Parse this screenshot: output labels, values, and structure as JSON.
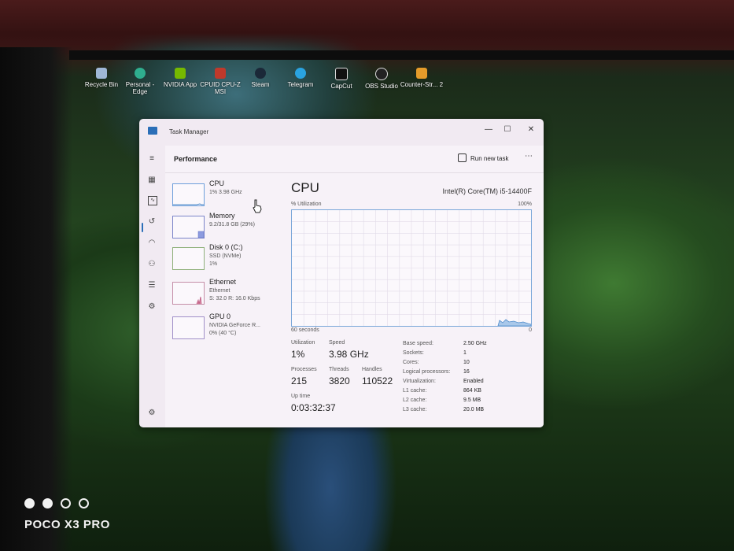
{
  "desktop_icons": [
    {
      "label": "Recycle Bin",
      "icon": "recycle-bin-icon",
      "color": "#9fb7d6"
    },
    {
      "label": "Personal - Edge",
      "icon": "edge-icon",
      "color": "#2fae8f"
    },
    {
      "label": "NVIDIA App",
      "icon": "nvidia-icon",
      "color": "#76b900"
    },
    {
      "label": "CPUID CPU-Z MSI",
      "icon": "cpuz-icon",
      "color": "#c0392b"
    },
    {
      "label": "Steam",
      "icon": "steam-icon",
      "color": "#1b2838"
    },
    {
      "label": "Telegram",
      "icon": "telegram-icon",
      "color": "#2aa3e0"
    },
    {
      "label": "CapCut",
      "icon": "capcut-icon",
      "color": "#111111"
    },
    {
      "label": "OBS Studio",
      "icon": "obs-icon",
      "color": "#222222"
    },
    {
      "label": "Counter-Str... 2",
      "icon": "cs2-icon",
      "color": "#e59b2a"
    }
  ],
  "window": {
    "title": "Task Manager",
    "minimize": "—",
    "maximize": "☐",
    "close": "✕"
  },
  "nav_icons": [
    "hamburger-icon",
    "processes-icon",
    "performance-icon",
    "app-history-icon",
    "startup-icon",
    "users-icon",
    "details-icon",
    "services-icon",
    "settings-icon"
  ],
  "header": {
    "title": "Performance",
    "run_new_task": "Run new task",
    "more": "⋯"
  },
  "resources": [
    {
      "name": "CPU",
      "sub1": "1% 3.98 GHz",
      "sub2": ""
    },
    {
      "name": "Memory",
      "sub1": "9.2/31.8 GB (29%)",
      "sub2": ""
    },
    {
      "name": "Disk 0 (C:)",
      "sub1": "SSD (NVMe)",
      "sub2": "1%"
    },
    {
      "name": "Ethernet",
      "sub1": "Ethernet",
      "sub2": "S: 32.0 R: 16.0 Kbps"
    },
    {
      "name": "GPU 0",
      "sub1": "NVIDIA GeForce R...",
      "sub2": "0% (40 °C)"
    }
  ],
  "cpu": {
    "title": "CPU",
    "model": "Intel(R) Core(TM) i5-14400F",
    "util_label": "% Utilization",
    "max_label": "100%",
    "time_label": "60 seconds",
    "min_label": "0",
    "utilization_label": "Utilization",
    "utilization": "1%",
    "speed_label": "Speed",
    "speed": "3.98 GHz",
    "processes_label": "Processes",
    "processes": "215",
    "threads_label": "Threads",
    "threads": "3820",
    "handles_label": "Handles",
    "handles": "110522",
    "uptime_label": "Up time",
    "uptime": "0:03:32:37",
    "specs": [
      {
        "k": "Base speed:",
        "v": "2.50 GHz"
      },
      {
        "k": "Sockets:",
        "v": "1"
      },
      {
        "k": "Cores:",
        "v": "10"
      },
      {
        "k": "Logical processors:",
        "v": "16"
      },
      {
        "k": "Virtualization:",
        "v": "Enabled"
      },
      {
        "k": "L1 cache:",
        "v": "864 KB"
      },
      {
        "k": "L2 cache:",
        "v": "9.5 MB"
      },
      {
        "k": "L3 cache:",
        "v": "20.0 MB"
      }
    ]
  },
  "accent_color": "#2b6fb8",
  "watermark": "POCO X3 PRO"
}
